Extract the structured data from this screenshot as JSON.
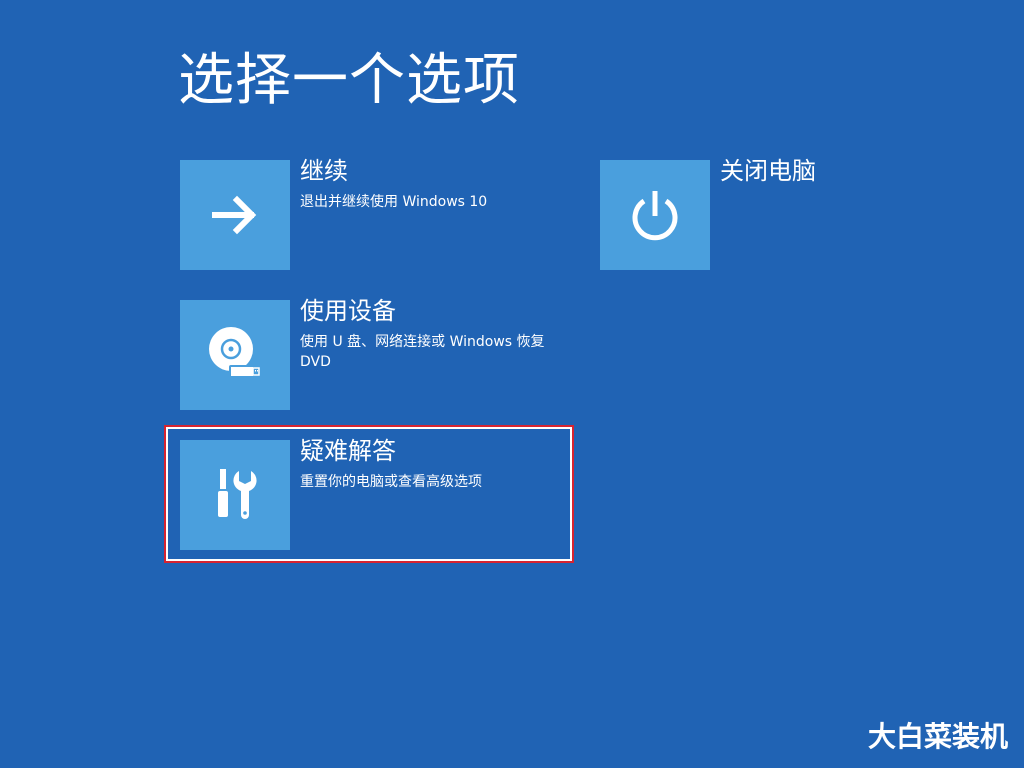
{
  "page": {
    "title": "选择一个选项"
  },
  "options": [
    {
      "id": "continue",
      "title": "继续",
      "description": "退出并继续使用 Windows 10",
      "icon": "arrow-right-icon"
    },
    {
      "id": "shutdown",
      "title": "关闭电脑",
      "description": "",
      "icon": "power-icon"
    },
    {
      "id": "use-device",
      "title": "使用设备",
      "description": "使用 U 盘、网络连接或 Windows 恢复 DVD",
      "icon": "disc-usb-icon"
    },
    {
      "id": "troubleshoot",
      "title": "疑难解答",
      "description": "重置你的电脑或查看高级选项",
      "icon": "tools-icon",
      "selected": true
    }
  ],
  "watermark": "大白菜装机",
  "colors": {
    "background": "#2063b4",
    "tile": "#4a9fdd",
    "selection_outline": "#d62431",
    "text": "#ffffff"
  }
}
